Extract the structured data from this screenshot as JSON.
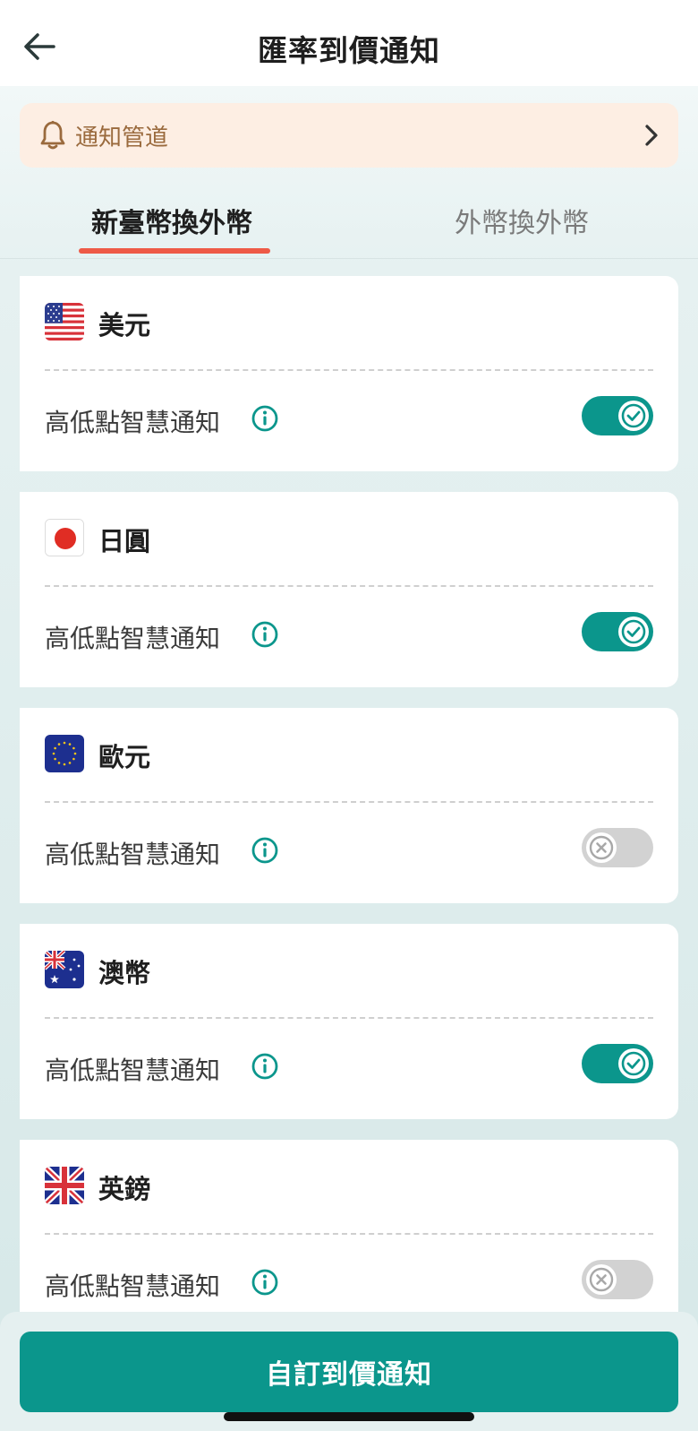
{
  "header": {
    "title": "匯率到價通知"
  },
  "channel": {
    "label": "通知管道"
  },
  "tabs": [
    {
      "label": "新臺幣換外幣",
      "active": true
    },
    {
      "label": "外幣換外幣",
      "active": false
    }
  ],
  "currencies": [
    {
      "name": "美元",
      "flag": "us-flag-icon",
      "alert_label": "高低點智慧通知",
      "enabled": true
    },
    {
      "name": "日圓",
      "flag": "jp-flag-icon",
      "alert_label": "高低點智慧通知",
      "enabled": true
    },
    {
      "name": "歐元",
      "flag": "eu-flag-icon",
      "alert_label": "高低點智慧通知",
      "enabled": false
    },
    {
      "name": "澳幣",
      "flag": "au-flag-icon",
      "alert_label": "高低點智慧通知",
      "enabled": true
    },
    {
      "name": "英鎊",
      "flag": "gb-flag-icon",
      "alert_label": "高低點智慧通知",
      "enabled": false
    }
  ],
  "cta": {
    "label": "自訂到價通知"
  },
  "colors": {
    "accent": "#0b968c",
    "tab_underline": "#ee5a47",
    "channel_bg": "#fdeee3",
    "channel_text": "#9a6a3d"
  }
}
